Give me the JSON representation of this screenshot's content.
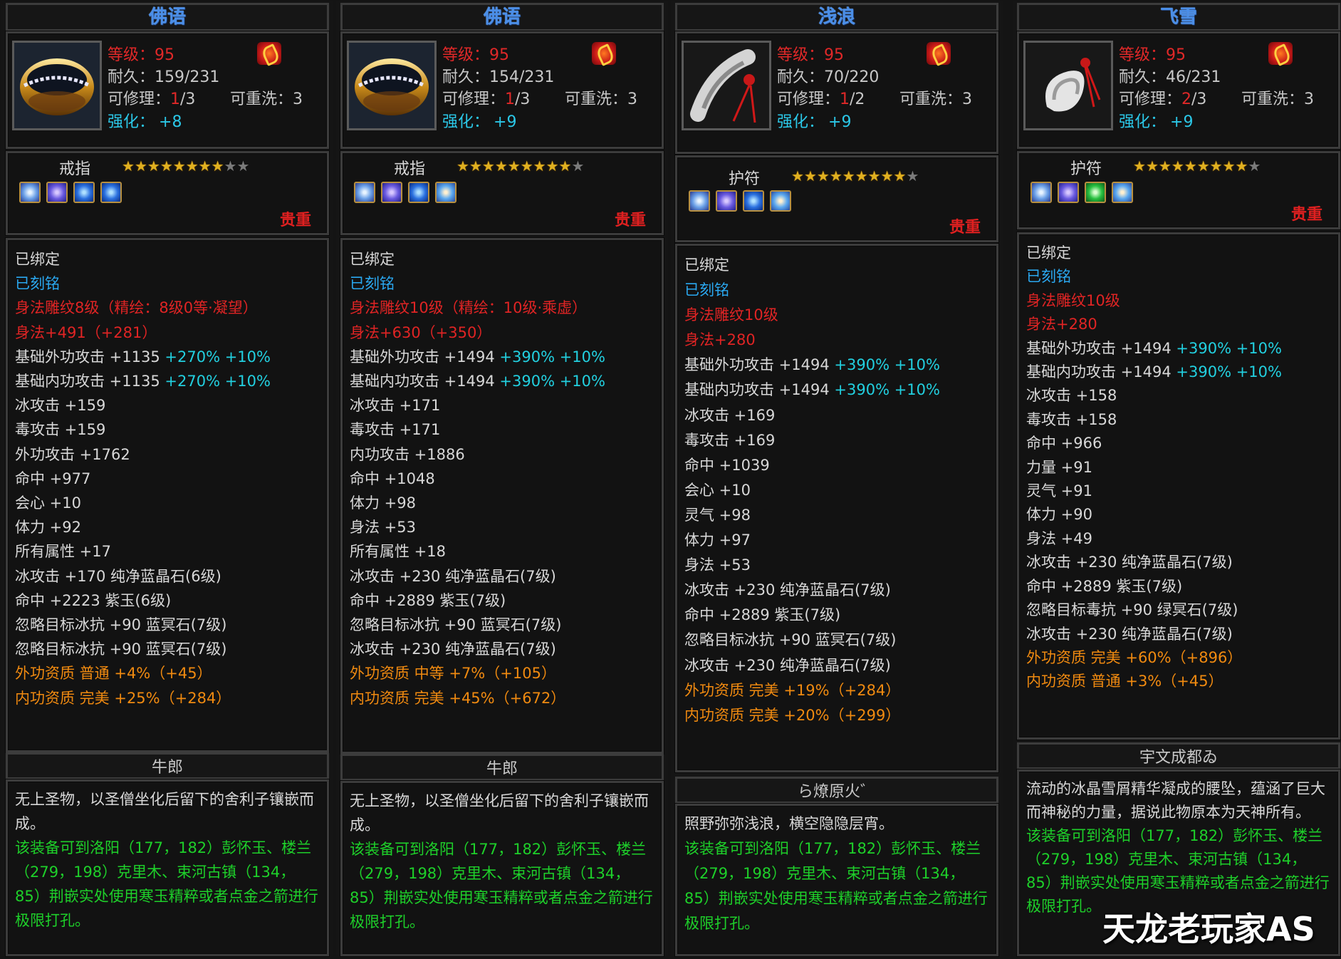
{
  "panels": [
    {
      "title": "佛语",
      "level": "等级：95",
      "durability": "耐久：159/231",
      "repair_label": "可修理：",
      "repair_used": "1",
      "repair_total": "/3",
      "rewash": "可重洗：3",
      "enhance_label": "强化：",
      "enhance_value": "+8",
      "type": "戒指",
      "stars_on": 8,
      "stars_total": 9,
      "gems": [
        "gem-a",
        "gem-b",
        "gem-c",
        "gem-c"
      ],
      "precious": "贵重",
      "lines": [
        {
          "t": "已绑定",
          "c": "c-white"
        },
        {
          "t": "已刻铭",
          "c": "c-blue"
        },
        {
          "t": "身法雕纹8级（精绘：8级0等·凝望）",
          "c": "c-red"
        },
        {
          "t": "身法+491（+281）",
          "c": "c-red"
        },
        {
          "t": "基础外功攻击 +1135 ",
          "c": "c-white",
          "x": "+270% +10%"
        },
        {
          "t": "基础内功攻击 +1135 ",
          "c": "c-white",
          "x": "+270% +10%"
        },
        {
          "t": "冰攻击 +159",
          "c": "c-white"
        },
        {
          "t": "毒攻击 +159",
          "c": "c-white"
        },
        {
          "t": "外功攻击 +1762",
          "c": "c-white"
        },
        {
          "t": "命中 +977",
          "c": "c-white"
        },
        {
          "t": "会心 +10",
          "c": "c-white"
        },
        {
          "t": "体力 +92",
          "c": "c-white"
        },
        {
          "t": "所有属性 +17",
          "c": "c-white"
        },
        {
          "t": "冰攻击 +170 纯净蓝晶石(6级)",
          "c": "c-white"
        },
        {
          "t": "命中 +2223 紫玉(6级)",
          "c": "c-white"
        },
        {
          "t": "忽略目标冰抗 +90 蓝冥石(7级)",
          "c": "c-white"
        },
        {
          "t": "忽略目标冰抗 +90 蓝冥石(7级)",
          "c": "c-white"
        },
        {
          "t": "外功资质 普通 +4%（+45）",
          "c": "c-orange"
        },
        {
          "t": "内功资质 完美 +25%（+284）",
          "c": "c-orange"
        }
      ],
      "maker": "牛郎",
      "desc_white": "无上圣物，以圣僧坐化后留下的舍利子镶嵌而成。",
      "desc_green": "该装备可到洛阳（177，182）彭怀玉、楼兰（279，198）克里木、束河古镇（134，85）荆嵌实处使用寒玉精粹或者点金之箭进行极限打孔。"
    },
    {
      "title": "佛语",
      "level": "等级：95",
      "durability": "耐久：154/231",
      "repair_label": "可修理：",
      "repair_used": "1",
      "repair_total": "/3",
      "rewash": "可重洗：3",
      "enhance_label": "强化：",
      "enhance_value": "+9",
      "type": "戒指",
      "stars_on": 9,
      "stars_total": 9,
      "gems": [
        "gem-a",
        "gem-b",
        "gem-c",
        "gem-d"
      ],
      "precious": "贵重",
      "lines": [
        {
          "t": "已绑定",
          "c": "c-white"
        },
        {
          "t": "已刻铭",
          "c": "c-blue"
        },
        {
          "t": "身法雕纹10级（精绘：10级·乘虚）",
          "c": "c-red"
        },
        {
          "t": "身法+630（+350）",
          "c": "c-red"
        },
        {
          "t": "基础外功攻击 +1494 ",
          "c": "c-white",
          "x": "+390% +10%"
        },
        {
          "t": "基础内功攻击 +1494 ",
          "c": "c-white",
          "x": "+390% +10%"
        },
        {
          "t": "冰攻击 +171",
          "c": "c-white"
        },
        {
          "t": "毒攻击 +171",
          "c": "c-white"
        },
        {
          "t": "内功攻击 +1886",
          "c": "c-white"
        },
        {
          "t": "命中 +1048",
          "c": "c-white"
        },
        {
          "t": "体力 +98",
          "c": "c-white"
        },
        {
          "t": "身法 +53",
          "c": "c-white"
        },
        {
          "t": "所有属性 +18",
          "c": "c-white"
        },
        {
          "t": "冰攻击 +230 纯净蓝晶石(7级)",
          "c": "c-white"
        },
        {
          "t": "命中 +2889 紫玉(7级)",
          "c": "c-white"
        },
        {
          "t": "忽略目标冰抗 +90 蓝冥石(7级)",
          "c": "c-white"
        },
        {
          "t": "冰攻击 +230 纯净蓝晶石(7级)",
          "c": "c-white"
        },
        {
          "t": "外功资质 中等 +7%（+105）",
          "c": "c-orange"
        },
        {
          "t": "内功资质 完美 +45%（+672）",
          "c": "c-orange"
        }
      ],
      "maker": "牛郎",
      "desc_white": "无上圣物，以圣僧坐化后留下的舍利子镶嵌而成。",
      "desc_green": "该装备可到洛阳（177，182）彭怀玉、楼兰（279，198）克里木、束河古镇（134，85）荆嵌实处使用寒玉精粹或者点金之箭进行极限打孔。"
    },
    {
      "title": "浅浪",
      "level": "等级：95",
      "durability": "耐久：70/220",
      "repair_label": "可修理：",
      "repair_used": "1",
      "repair_total": "/2",
      "rewash": "可重洗：3",
      "enhance_label": "强化：",
      "enhance_value": "+9",
      "type": "护符",
      "stars_on": 9,
      "stars_total": 9,
      "gems": [
        "gem-a",
        "gem-b",
        "gem-c",
        "gem-d"
      ],
      "precious": "贵重",
      "lines": [
        {
          "t": "已绑定",
          "c": "c-white"
        },
        {
          "t": "已刻铭",
          "c": "c-blue"
        },
        {
          "t": "身法雕纹10级",
          "c": "c-red"
        },
        {
          "t": "身法+280",
          "c": "c-red"
        },
        {
          "t": "基础外功攻击 +1494 ",
          "c": "c-white",
          "x": "+390% +10%"
        },
        {
          "t": "基础内功攻击 +1494 ",
          "c": "c-white",
          "x": "+390% +10%"
        },
        {
          "t": "冰攻击 +169",
          "c": "c-white"
        },
        {
          "t": "毒攻击 +169",
          "c": "c-white"
        },
        {
          "t": "命中 +1039",
          "c": "c-white"
        },
        {
          "t": "会心 +10",
          "c": "c-white"
        },
        {
          "t": "灵气 +98",
          "c": "c-white"
        },
        {
          "t": "体力 +97",
          "c": "c-white"
        },
        {
          "t": "身法 +53",
          "c": "c-white"
        },
        {
          "t": "冰攻击 +230 纯净蓝晶石(7级)",
          "c": "c-white"
        },
        {
          "t": "命中 +2889 紫玉(7级)",
          "c": "c-white"
        },
        {
          "t": "忽略目标冰抗 +90 蓝冥石(7级)",
          "c": "c-white"
        },
        {
          "t": "冰攻击 +230 纯净蓝晶石(7级)",
          "c": "c-white"
        },
        {
          "t": "外功资质 完美 +19%（+284）",
          "c": "c-orange"
        },
        {
          "t": "内功资质 完美 +20%（+299）",
          "c": "c-orange"
        }
      ],
      "maker": "ら燎原火゛",
      "desc_white": "照野弥弥浅浪，横空隐隐层宵。",
      "desc_green": "该装备可到洛阳（177，182）彭怀玉、楼兰（279，198）克里木、束河古镇（134，85）荆嵌实处使用寒玉精粹或者点金之箭进行极限打孔。"
    },
    {
      "title": "飞雪",
      "level": "等级：95",
      "durability": "耐久：46/231",
      "repair_label": "可修理：",
      "repair_used": "2",
      "repair_total": "/3",
      "rewash": "可重洗：3",
      "enhance_label": "强化：",
      "enhance_value": "+9",
      "type": "护符",
      "stars_on": 9,
      "stars_total": 9,
      "gems": [
        "gem-a",
        "gem-b",
        "gem-e",
        "gem-d"
      ],
      "precious": "贵重",
      "lines": [
        {
          "t": "已绑定",
          "c": "c-white"
        },
        {
          "t": "已刻铭",
          "c": "c-blue"
        },
        {
          "t": "身法雕纹10级",
          "c": "c-red"
        },
        {
          "t": "身法+280",
          "c": "c-red"
        },
        {
          "t": "基础外功攻击 +1494 ",
          "c": "c-white",
          "x": "+390% +10%"
        },
        {
          "t": "基础内功攻击 +1494 ",
          "c": "c-white",
          "x": "+390% +10%"
        },
        {
          "t": "冰攻击 +158",
          "c": "c-white"
        },
        {
          "t": "毒攻击 +158",
          "c": "c-white"
        },
        {
          "t": "命中 +966",
          "c": "c-white"
        },
        {
          "t": "力量 +91",
          "c": "c-white"
        },
        {
          "t": "灵气 +91",
          "c": "c-white"
        },
        {
          "t": "体力 +90",
          "c": "c-white"
        },
        {
          "t": "身法 +49",
          "c": "c-white"
        },
        {
          "t": "冰攻击 +230 纯净蓝晶石(7级)",
          "c": "c-white"
        },
        {
          "t": "命中 +2889 紫玉(7级)",
          "c": "c-white"
        },
        {
          "t": "忽略目标毒抗 +90 绿冥石(7级)",
          "c": "c-white"
        },
        {
          "t": "冰攻击 +230 纯净蓝晶石(7级)",
          "c": "c-white"
        },
        {
          "t": "外功资质 完美 +60%（+896）",
          "c": "c-orange"
        },
        {
          "t": "内功资质 普通 +3%（+45）",
          "c": "c-orange"
        }
      ],
      "maker": "宇文成都ゐ",
      "desc_white": "流动的冰晶雪屑精华凝成的腰坠，蕴涵了巨大而神秘的力量，据说此物原本为天神所有。",
      "desc_green": "该装备可到洛阳（177，182）彭怀玉、楼兰（279，198）克里木、束河古镇（134，85）荆嵌实处使用寒玉精粹或者点金之箭进行极限打孔。"
    }
  ],
  "watermark": "天龙老玩家AS"
}
